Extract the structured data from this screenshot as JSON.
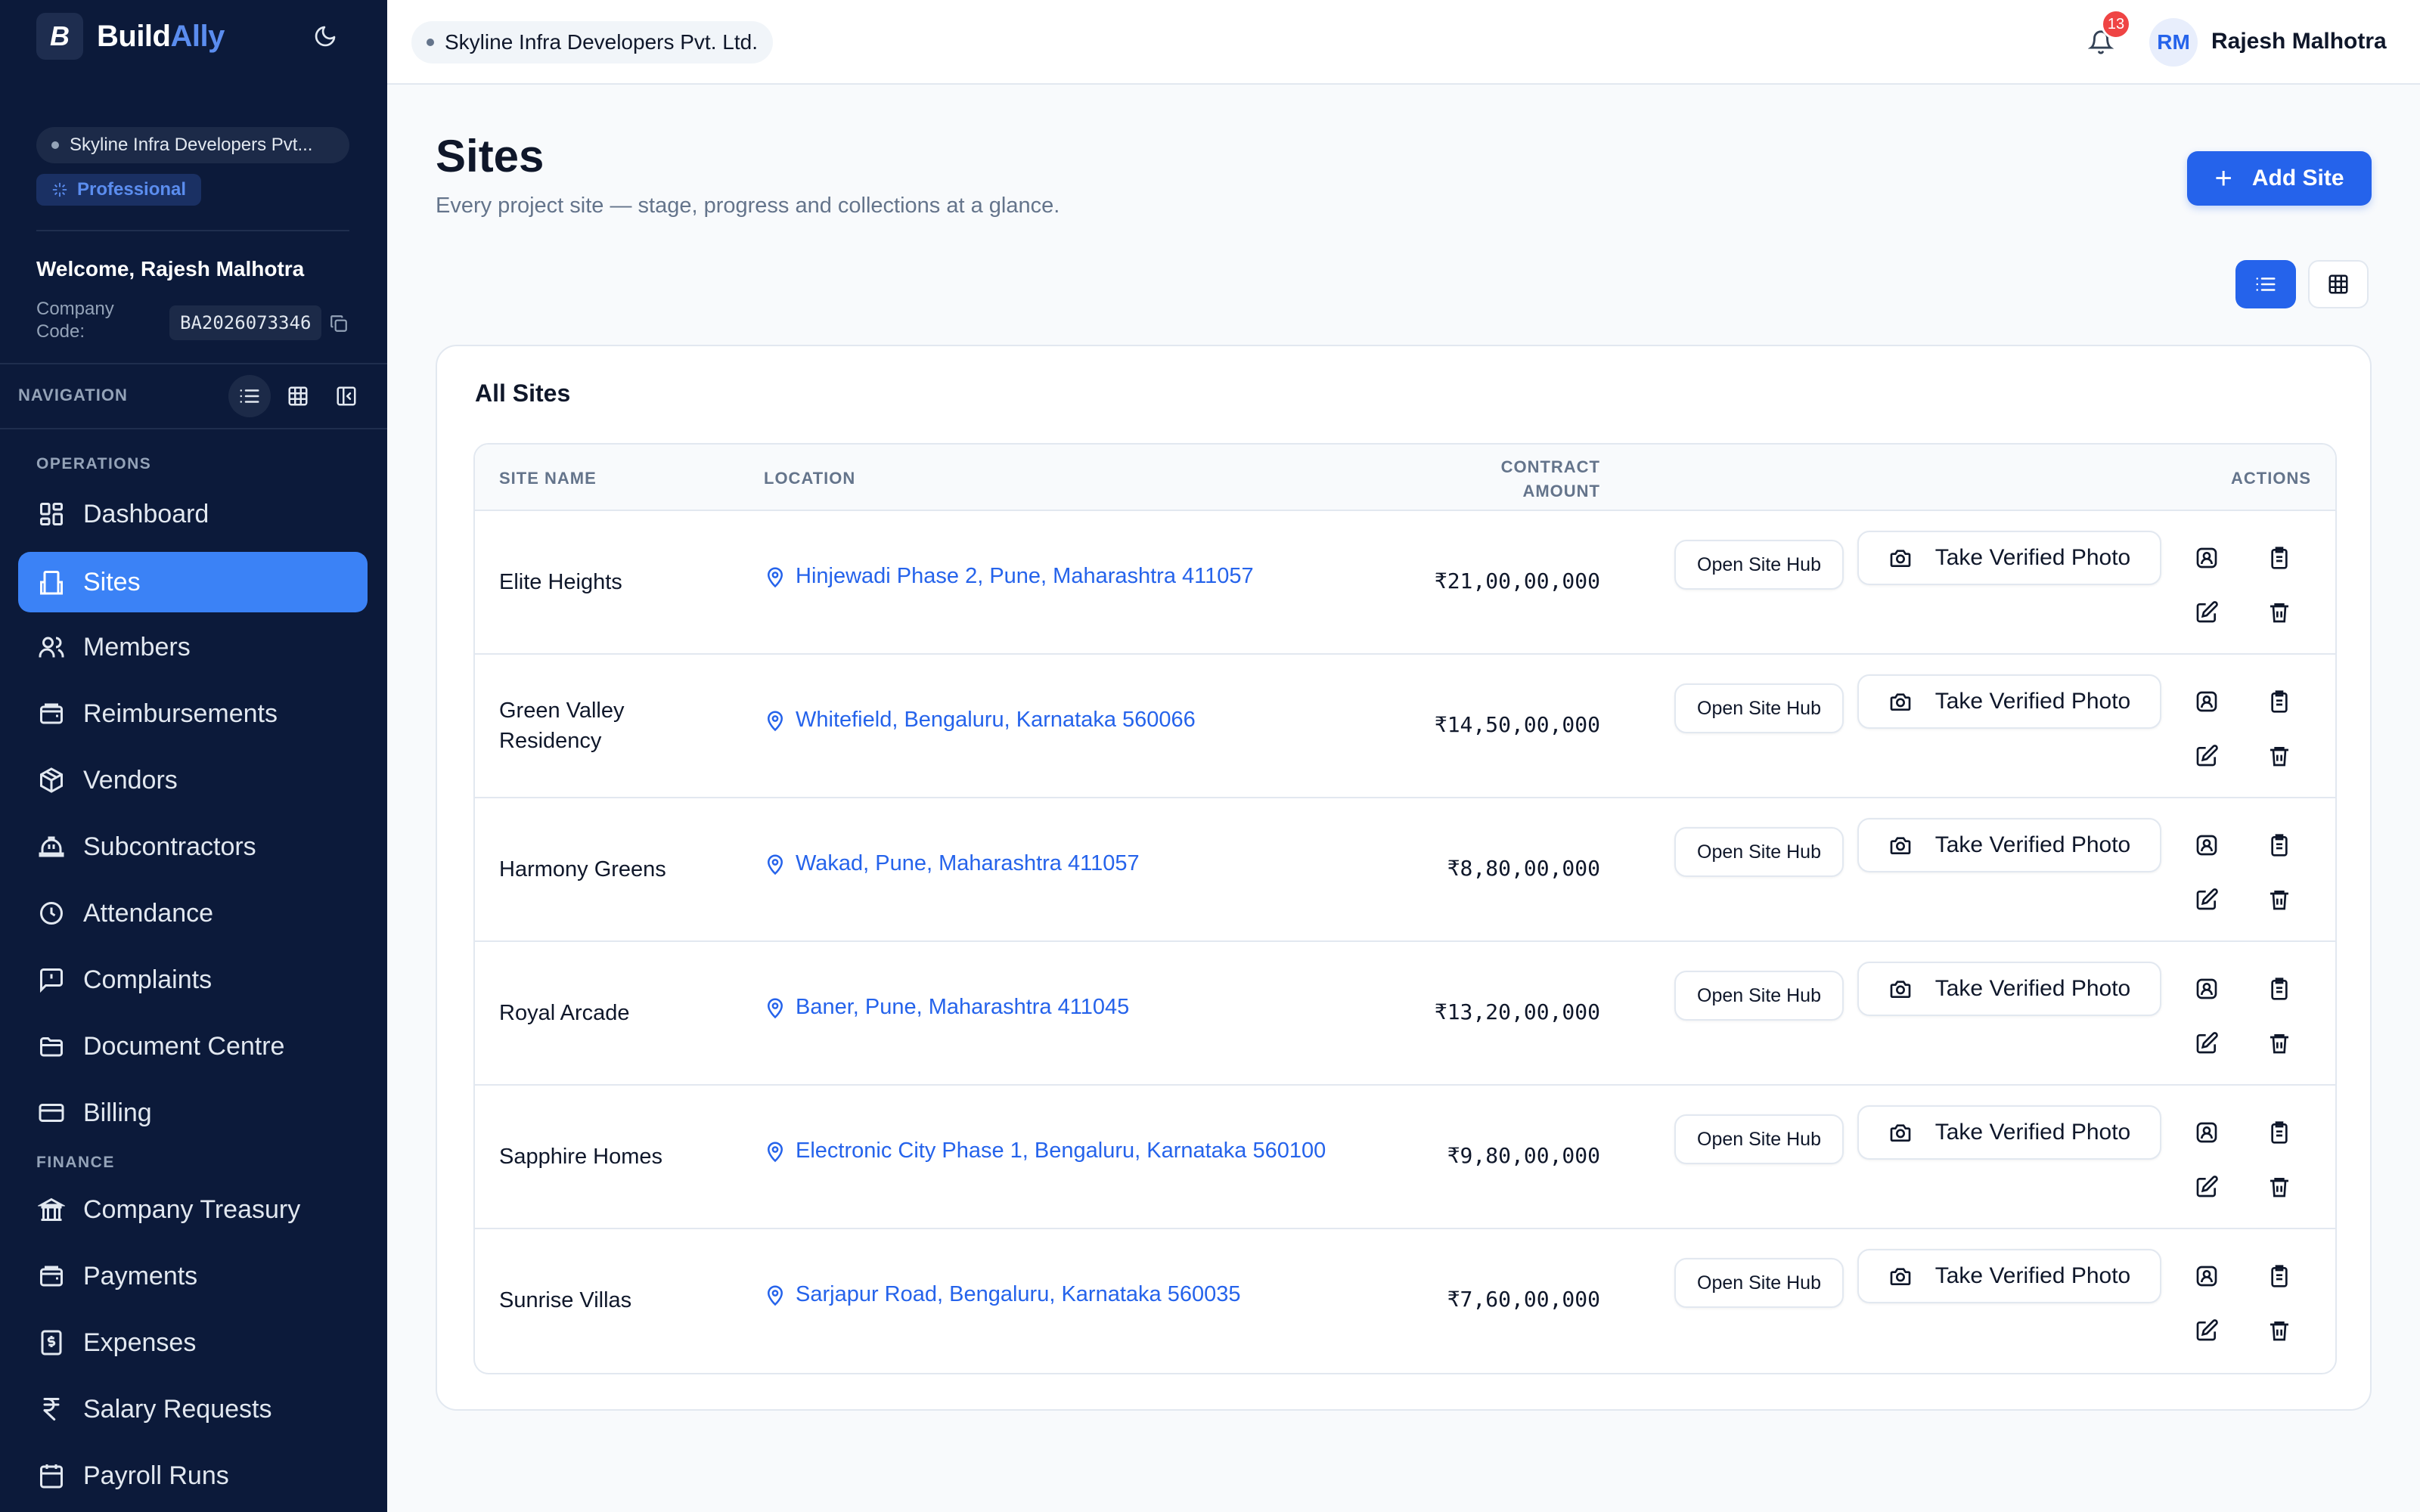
{
  "brand": {
    "logo_letter": "B",
    "name_part1": "Build",
    "name_part2": "Ally"
  },
  "sidebar": {
    "org_name": "Skyline Infra Developers Pvt...",
    "plan": "Professional",
    "welcome": "Welcome, Rajesh Malhotra",
    "company_code_label": "Company Code:",
    "company_code": "BA2026073346",
    "nav_label": "NAVIGATION",
    "sections": {
      "operations": "OPERATIONS",
      "finance": "FINANCE"
    },
    "items": [
      {
        "label": "Dashboard",
        "icon": "dashboard-icon"
      },
      {
        "label": "Sites",
        "icon": "building-icon",
        "active": true
      },
      {
        "label": "Members",
        "icon": "users-icon"
      },
      {
        "label": "Reimbursements",
        "icon": "wallet-icon"
      },
      {
        "label": "Vendors",
        "icon": "package-icon"
      },
      {
        "label": "Subcontractors",
        "icon": "hardhat-icon"
      },
      {
        "label": "Attendance",
        "icon": "clock-icon"
      },
      {
        "label": "Complaints",
        "icon": "message-alert-icon"
      },
      {
        "label": "Document Centre",
        "icon": "folder-icon"
      },
      {
        "label": "Billing",
        "icon": "credit-card-icon"
      },
      {
        "label": "Company Treasury",
        "icon": "bank-icon"
      },
      {
        "label": "Payments",
        "icon": "wallet-icon"
      },
      {
        "label": "Expenses",
        "icon": "receipt-icon"
      },
      {
        "label": "Salary Requests",
        "icon": "rupee-icon"
      },
      {
        "label": "Payroll Runs",
        "icon": "calendar-icon"
      }
    ]
  },
  "topbar": {
    "org_name": "Skyline Infra Developers Pvt. Ltd.",
    "notifications": "13",
    "avatar_initials": "RM",
    "user_name": "Rajesh Malhotra"
  },
  "page": {
    "title": "Sites",
    "subtitle": "Every project site — stage, progress and collections at a glance.",
    "add_button": "Add Site",
    "card_title": "All Sites"
  },
  "table": {
    "headers": {
      "site_name": "SITE NAME",
      "location": "LOCATION",
      "contract_line1": "CONTRACT",
      "contract_line2": "AMOUNT",
      "actions": "ACTIONS"
    },
    "open_hub_label": "Open Site Hub",
    "photo_label": "Take Verified Photo",
    "rows": [
      {
        "name": "Elite Heights",
        "location": "Hinjewadi Phase 2, Pune, Maharashtra 411057",
        "amount": "₹21,00,00,000"
      },
      {
        "name": "Green Valley Residency",
        "location": "Whitefield, Bengaluru, Karnataka 560066",
        "amount": "₹14,50,00,000"
      },
      {
        "name": "Harmony Greens",
        "location": "Wakad, Pune, Maharashtra 411057",
        "amount": "₹8,80,00,000"
      },
      {
        "name": "Royal Arcade",
        "location": "Baner, Pune, Maharashtra 411045",
        "amount": "₹13,20,00,000"
      },
      {
        "name": "Sapphire Homes",
        "location": "Electronic City Phase 1, Bengaluru, Karnataka 560100",
        "amount": "₹9,80,00,000"
      },
      {
        "name": "Sunrise Villas",
        "location": "Sarjapur Road, Bengaluru, Karnataka 560035",
        "amount": "₹7,60,00,000"
      }
    ]
  },
  "colors": {
    "sidebar_bg": "#0c1a3a",
    "accent": "#2563eb",
    "active_nav": "#3b82f6",
    "badge": "#ef4444"
  }
}
